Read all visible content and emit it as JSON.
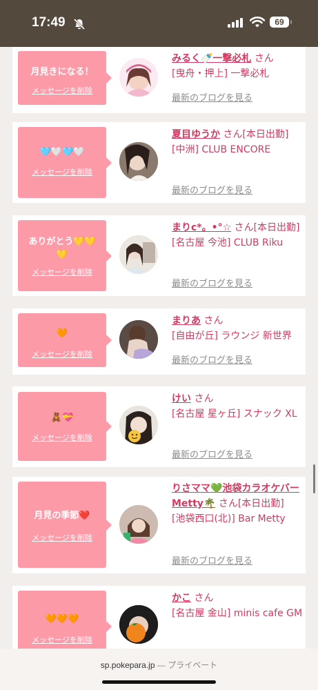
{
  "status_bar": {
    "time": "17:49",
    "battery": "69"
  },
  "browser": {
    "domain": "sp.pokepara.jp",
    "mode": "— プライベート"
  },
  "delete_label": "メッセージを削除",
  "blog_label": "最新のブログを見る",
  "san_label": "さん",
  "cards": [
    {
      "message": "月見きになる！",
      "name": "みるく🍼一撃必札",
      "status": "",
      "area": "[曳舟・押上] 一撃必札"
    },
    {
      "message": "🩵🤍🩵🤍",
      "name": "夏目ゆうか",
      "status": "[本日出勤]",
      "area": "[中洲] CLUB ENCORE"
    },
    {
      "message": "ありがとう💛💛💛",
      "name": "まりc*。•°☆",
      "status": "[本日出勤]",
      "area": "[名古屋 今池] CLUB Riku"
    },
    {
      "message": "🧡",
      "name": "まりあ",
      "status": "",
      "area": "[自由が丘] ラウンジ 新世界"
    },
    {
      "message": "🧸💝",
      "name": "けい",
      "status": "",
      "area": "[名古屋 星ヶ丘] スナック XL"
    },
    {
      "message": "月見の季節❤️",
      "name": "りさママ💚池袋カラオケバーMetty🌴",
      "status": "[本日出勤]",
      "area": "[池袋西口(北)] Bar Metty"
    },
    {
      "message": "🧡🧡🧡",
      "name": "かこ",
      "status": "",
      "area": "[名古屋 金山] minis cafe GM"
    }
  ]
}
